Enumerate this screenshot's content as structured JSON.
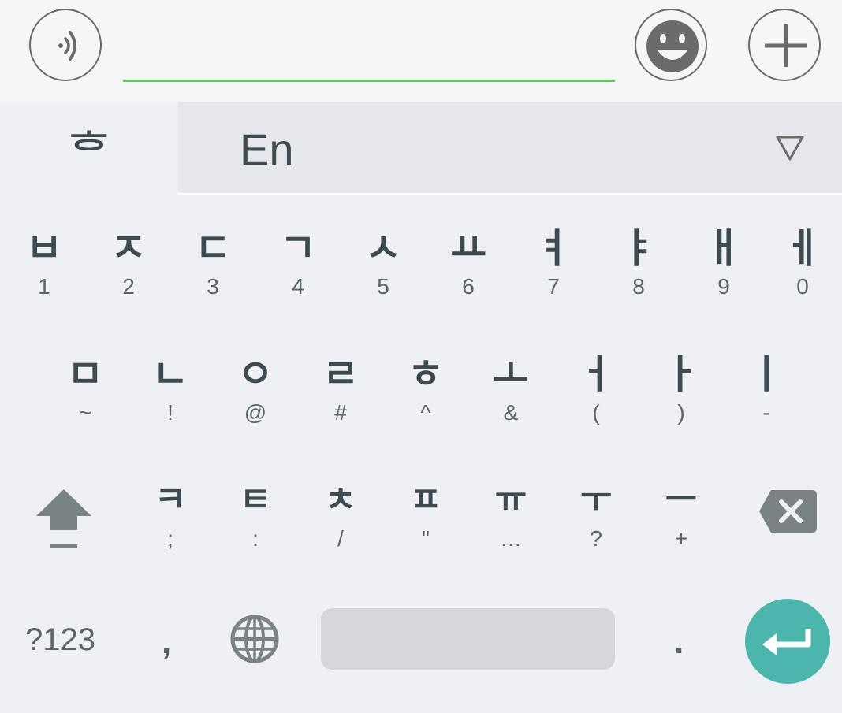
{
  "toolbar": {
    "voice_icon": "voice-icon",
    "emoji_icon": "emoji-icon",
    "add_icon": "plus-icon",
    "input_value": "",
    "accent_color": "#5dc85d"
  },
  "language_bar": {
    "active": "ᄒ",
    "other": "En",
    "dropdown_icon": "triangle-down-icon"
  },
  "rows": {
    "row1": [
      {
        "main": "ㅂ",
        "sub": "1"
      },
      {
        "main": "ㅈ",
        "sub": "2"
      },
      {
        "main": "ㄷ",
        "sub": "3"
      },
      {
        "main": "ㄱ",
        "sub": "4"
      },
      {
        "main": "ㅅ",
        "sub": "5"
      },
      {
        "main": "ㅛ",
        "sub": "6"
      },
      {
        "main": "ㅕ",
        "sub": "7"
      },
      {
        "main": "ㅑ",
        "sub": "8"
      },
      {
        "main": "ㅐ",
        "sub": "9"
      },
      {
        "main": "ㅔ",
        "sub": "0"
      }
    ],
    "row2": [
      {
        "main": "ㅁ",
        "sub": "~"
      },
      {
        "main": "ㄴ",
        "sub": "!"
      },
      {
        "main": "ㅇ",
        "sub": "@"
      },
      {
        "main": "ㄹ",
        "sub": "#"
      },
      {
        "main": "ㅎ",
        "sub": "^"
      },
      {
        "main": "ㅗ",
        "sub": "&"
      },
      {
        "main": "ㅓ",
        "sub": "("
      },
      {
        "main": "ㅏ",
        "sub": ")"
      },
      {
        "main": "ㅣ",
        "sub": "-"
      }
    ],
    "row3": [
      {
        "main": "ㅋ",
        "sub": ";"
      },
      {
        "main": "ㅌ",
        "sub": ":"
      },
      {
        "main": "ㅊ",
        "sub": "/"
      },
      {
        "main": "ㅍ",
        "sub": "\""
      },
      {
        "main": "ㅠ",
        "sub": "…"
      },
      {
        "main": "ㅜ",
        "sub": "?"
      },
      {
        "main": "ㅡ",
        "sub": "+"
      }
    ]
  },
  "bottom": {
    "symbols_label": "?123",
    "comma_label": ",",
    "period_label": ".",
    "globe_icon": "globe-icon",
    "enter_icon": "enter-icon",
    "enter_color": "#4db6ac"
  }
}
